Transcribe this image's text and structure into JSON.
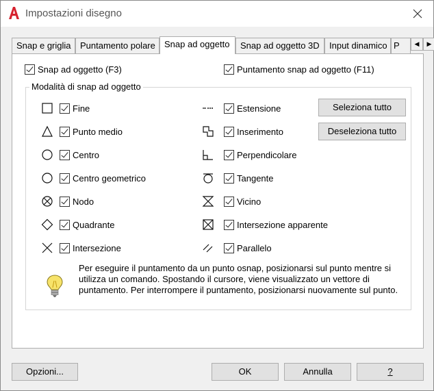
{
  "window": {
    "title": "Impostazioni disegno",
    "app_icon": "autocad-a-icon",
    "close_icon": "close-icon"
  },
  "tabs": [
    {
      "label": "Snap e griglia",
      "active": false
    },
    {
      "label": "Puntamento polare",
      "active": false
    },
    {
      "label": "Snap ad oggetto",
      "active": true
    },
    {
      "label": "Snap ad oggetto 3D",
      "active": false
    },
    {
      "label": "Input dinamico",
      "active": false
    },
    {
      "label": "P",
      "active": false
    }
  ],
  "tab_scroll": {
    "left": "◀",
    "right": "▶"
  },
  "top_options": {
    "snap_on": {
      "label": "Snap ad oggetto (F3)",
      "checked": true
    },
    "tracking_on": {
      "label": "Puntamento snap ad oggetto (F11)",
      "checked": true
    }
  },
  "group": {
    "title": "Modalità di snap ad oggetto",
    "left_modes": [
      {
        "label": "Fine",
        "checked": true,
        "icon": "endpoint-square-icon"
      },
      {
        "label": "Punto medio",
        "checked": true,
        "icon": "midpoint-triangle-icon"
      },
      {
        "label": "Centro",
        "checked": true,
        "icon": "center-circle-icon"
      },
      {
        "label": "Centro geometrico",
        "checked": true,
        "icon": "geometric-center-icon"
      },
      {
        "label": "Nodo",
        "checked": true,
        "icon": "node-icon"
      },
      {
        "label": "Quadrante",
        "checked": true,
        "icon": "quadrant-diamond-icon"
      },
      {
        "label": "Intersezione",
        "checked": true,
        "icon": "intersection-x-icon"
      }
    ],
    "right_modes": [
      {
        "label": "Estensione",
        "checked": true,
        "icon": "extension-icon"
      },
      {
        "label": "Inserimento",
        "checked": true,
        "icon": "insertion-icon"
      },
      {
        "label": "Perpendicolare",
        "checked": true,
        "icon": "perpendicular-icon"
      },
      {
        "label": "Tangente",
        "checked": true,
        "icon": "tangent-icon"
      },
      {
        "label": "Vicino",
        "checked": true,
        "icon": "nearest-hourglass-icon"
      },
      {
        "label": "Intersezione apparente",
        "checked": true,
        "icon": "apparent-intersection-icon"
      },
      {
        "label": "Parallelo",
        "checked": true,
        "icon": "parallel-icon"
      }
    ],
    "select_all": "Seleziona tutto",
    "clear_all": "Deseleziona tutto",
    "info": "Per eseguire il puntamento da un punto osnap, posizionarsi sul punto mentre si utilizza un comando. Spostando il cursore, viene visualizzato un vettore di puntamento. Per interrompere il puntamento, posizionarsi nuovamente sul punto.",
    "info_icon": "lightbulb-icon"
  },
  "footer": {
    "options": "Opzioni...",
    "ok": "OK",
    "cancel": "Annulla",
    "help": "?"
  }
}
